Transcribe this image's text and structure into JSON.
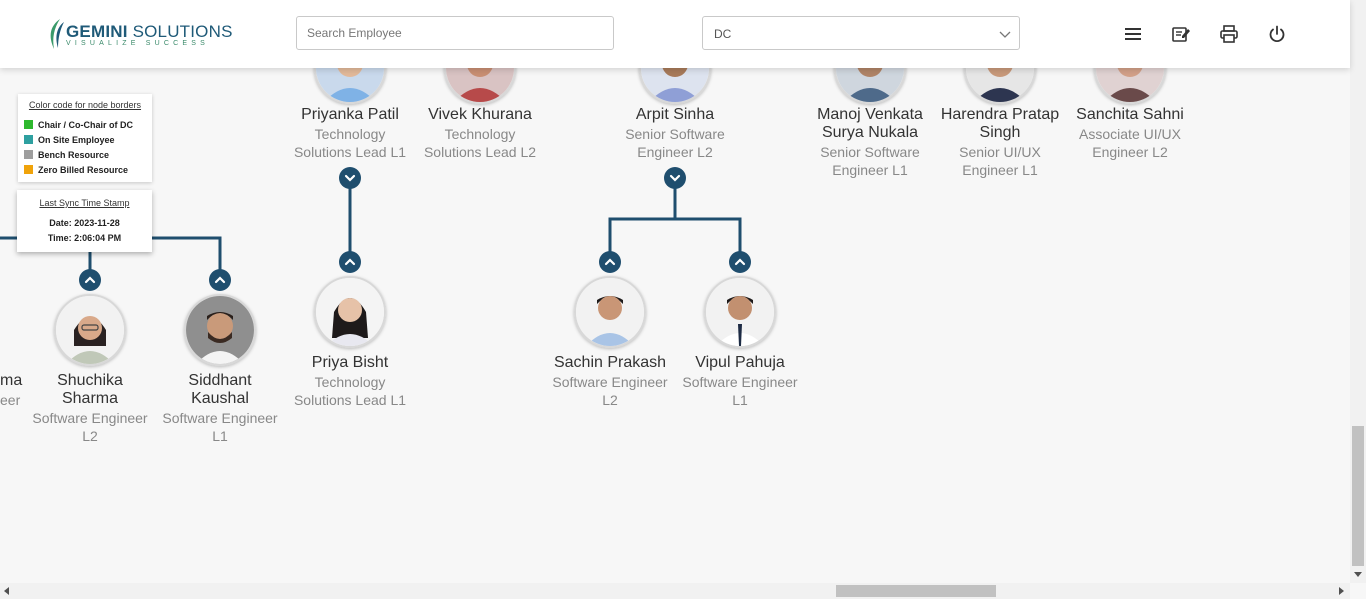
{
  "header": {
    "logo": {
      "name_bold": "GEMINI",
      "name_rest": " SOLUTIONS",
      "tagline": "VISUALIZE SUCCESS"
    },
    "search": {
      "placeholder": "Search Employee",
      "value": ""
    },
    "department_select": {
      "value": "DC"
    },
    "icons": [
      "menu-icon",
      "edit-note-icon",
      "print-icon",
      "power-icon"
    ]
  },
  "legend": {
    "title": "Color code for node borders",
    "items": [
      {
        "label": "Chair / Co-Chair of DC",
        "color": "#2eb82e"
      },
      {
        "label": "On Site Employee",
        "color": "#2ea0a0"
      },
      {
        "label": "Bench Resource",
        "color": "#9e9e9e"
      },
      {
        "label": "Zero Billed Resource",
        "color": "#f0a30a"
      }
    ]
  },
  "sync": {
    "title": "Last Sync Time Stamp",
    "date": "Date: 2023-11-28",
    "time": "Time: 2:06:04 PM"
  },
  "colors": {
    "connector": "#1f4e6e",
    "accent": "#1f5a78"
  },
  "tree": {
    "top_row": [
      {
        "name": "Priyanka Patil",
        "title": "Technology Solutions Lead L1"
      },
      {
        "name": "Vivek Khurana",
        "title": "Technology Solutions Lead L2"
      },
      {
        "name": "Arpit Sinha",
        "title": "Senior Software Engineer L2"
      },
      {
        "name": "Manoj Venkata Surya Nukala",
        "title": "Senior Software Engineer L1"
      },
      {
        "name": "Harendra Pratap Singh",
        "title": "Senior UI/UX Engineer L1"
      },
      {
        "name": "Sanchita Sahni",
        "title": "Associate UI/UX Engineer L2"
      }
    ],
    "children": [
      {
        "name": "Shuchika Sharma",
        "title": "Software Engineer L2"
      },
      {
        "name": "Siddhant Kaushal",
        "title": "Software Engineer L1"
      },
      {
        "name": "Priya Bisht",
        "title": "Technology Solutions Lead L1"
      },
      {
        "name": "Sachin Prakash",
        "title": "Software Engineer L2"
      },
      {
        "name": "Vipul Pahuja",
        "title": "Software Engineer L1"
      }
    ],
    "partial_left": {
      "name_fragment": "ma",
      "title_fragment": "eer"
    }
  }
}
